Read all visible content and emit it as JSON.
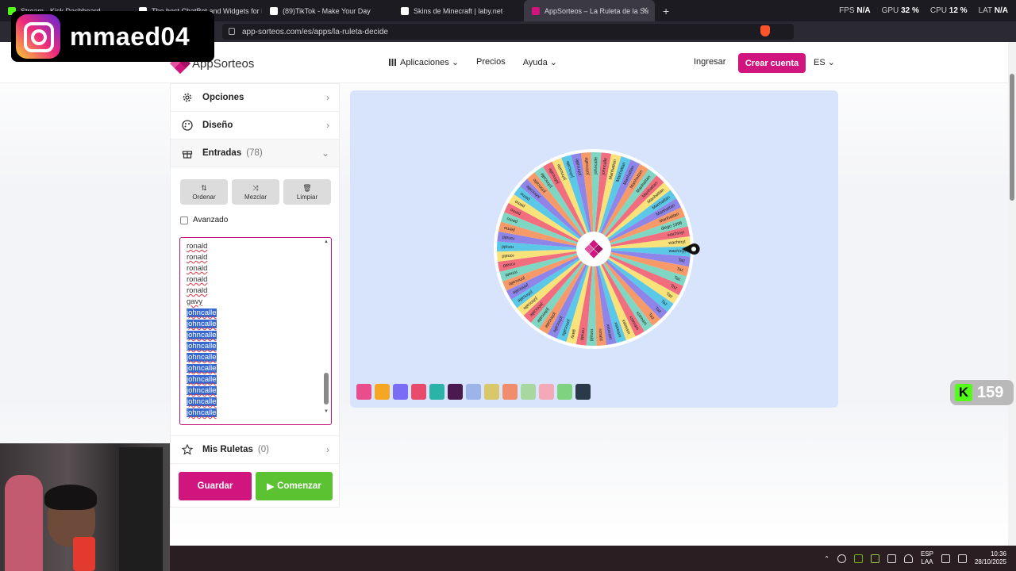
{
  "tabs": [
    {
      "label": "Stream - Kick Dashboard",
      "color": "#53fc18"
    },
    {
      "label": "The best ChatBot and Widgets for Ki",
      "color": "#ffffff"
    },
    {
      "label": "(89)TikTok - Make Your Day",
      "color": "#ffffff"
    },
    {
      "label": "Skins de Minecraft | laby.net",
      "color": "#ffffff"
    },
    {
      "label": "AppSorteos – La Ruleta de la Su",
      "color": "#d1157e"
    }
  ],
  "stats": {
    "fps_label": "FPS",
    "fps": "N/A",
    "gpu_label": "GPU",
    "gpu": "32 %",
    "cpu_label": "CPU",
    "cpu": "12 %",
    "lat_label": "LAT",
    "lat": "N/A"
  },
  "url": "app-sorteos.com/es/apps/la-ruleta-decide",
  "overlay": {
    "username": "mmaed04"
  },
  "nav": {
    "brand": "AppSorteos",
    "aplicaciones": "Aplicaciones",
    "precios": "Precios",
    "ayuda": "Ayuda",
    "ingresar": "Ingresar",
    "crear": "Crear cuenta",
    "lang": "ES"
  },
  "panel": {
    "opciones": "Opciones",
    "diseno": "Diseño",
    "entradas": "Entradas",
    "entradas_count": "(78)",
    "ordenar": "Ordenar",
    "mezclar": "Mezclar",
    "limpiar": "Limpiar",
    "avanzado": "Avanzado",
    "entries": [
      "ronald",
      "ronald",
      "ronald",
      "ronald",
      "ronald",
      "gavy",
      "johncalle",
      "johncalle",
      "johncalle",
      "johncalle",
      "johncalle",
      "johncalle",
      "johncalle",
      "johncalle",
      "johncalle",
      "johncalle"
    ],
    "mis_ruletas": "Mis Ruletas",
    "mis_count": "(0)",
    "guardar": "Guardar",
    "comenzar": "Comenzar"
  },
  "wheel": {
    "segments": [
      "johncalle",
      "Manhattan",
      "Manhattan",
      "Manhattan",
      "Manhattan",
      "Manhattan",
      "Manhattan",
      "Manhattan",
      "Manhattan",
      "Manhattan",
      "Manhattan",
      "diego 1996",
      "wachinyt",
      "wachinyt",
      "wachinyt",
      "Taz",
      "Taz",
      "Taz",
      "Taz",
      "Taz",
      "Taz",
      "Taz",
      "Taz",
      "xstream",
      "xstream",
      "xstream",
      "xstream",
      "xstream",
      "ronald",
      "ronald",
      "ronald",
      "gavy",
      "johncalle",
      "johncalle",
      "johncalle",
      "johncalle",
      "johncalle",
      "johncalle",
      "johncalle",
      "johncalle",
      "johncalle",
      "ronald",
      "ronald",
      "ronald",
      "ronald",
      "ronald",
      "pemo",
      "pemo",
      "pemo",
      "pemo",
      "pemo",
      "johncalle",
      "johncalle",
      "johncalle",
      "johncalle",
      "johncalle",
      "johncalle",
      "johncalle",
      "johncalle",
      "johncalle"
    ],
    "colors": [
      "#f26d7d",
      "#f9e27a",
      "#5bc8e8",
      "#8f85e8",
      "#f79a6a",
      "#7fd6c2"
    ]
  },
  "palette": [
    "#e94d8c",
    "#f5a623",
    "#7b6cf6",
    "#e84c6a",
    "#2ab3a6",
    "#4a1a4f",
    "#9db4e8",
    "#d9c76b",
    "#f08d6c",
    "#a8d8a0",
    "#f3a9b8",
    "#7fd27f",
    "#2b3a4a"
  ],
  "kick": {
    "count": "159"
  },
  "taskbar": {
    "lang1": "ESP",
    "lang2": "LAA",
    "time": "10:36",
    "date": "28/10/2025"
  }
}
